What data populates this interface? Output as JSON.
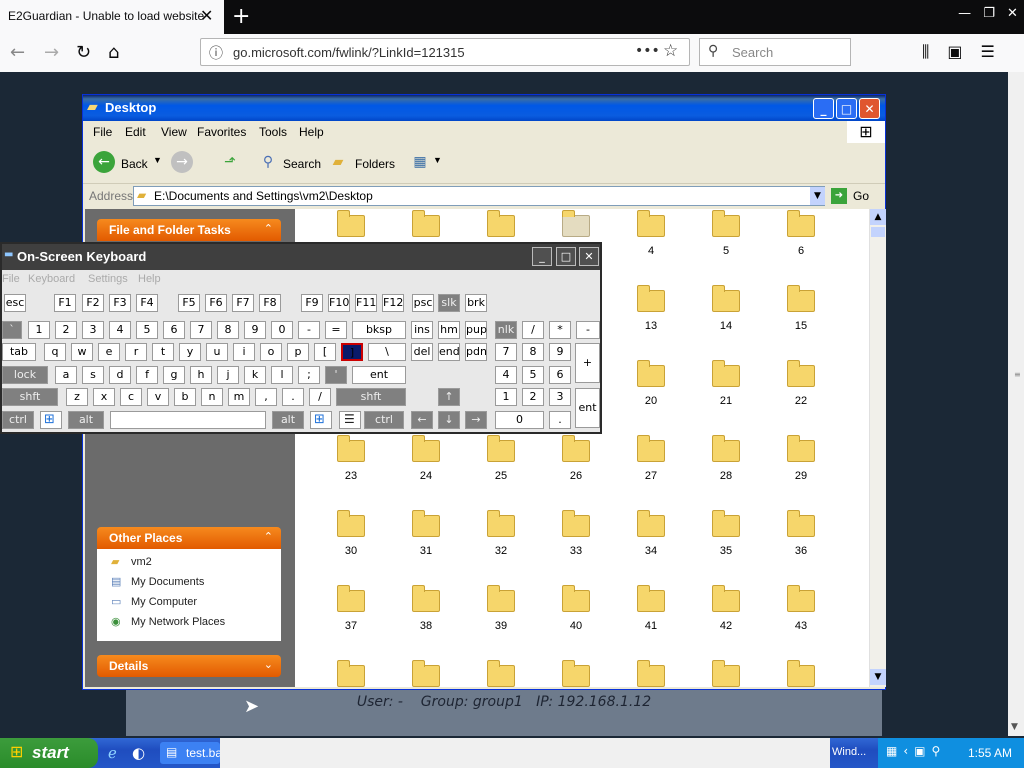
{
  "browser": {
    "tab_title": "E2Guardian - Unable to load website",
    "tab_close": "✕",
    "new_tab": "+",
    "win_min": "—",
    "win_restore": "❐",
    "win_close": "✕",
    "url": "go.microsoft.com/fwlink/?LinkId=121315",
    "url_more": "•••",
    "search_placeholder": "Search"
  },
  "remote": {
    "status_line": "User: -    Group: group1   IP: 192.168.1.12"
  },
  "explorer": {
    "title": "Desktop",
    "menu": [
      "File",
      "Edit",
      "View",
      "Favorites",
      "Tools",
      "Help"
    ],
    "toolbar": {
      "back": "Back",
      "search": "Search",
      "folders": "Folders"
    },
    "address_label": "Address",
    "address_value": "E:\\Documents and Settings\\vm2\\Desktop",
    "go_label": "Go",
    "panels": {
      "file_folder_tasks": "File and Folder Tasks",
      "other_places": "Other Places",
      "details": "Details"
    },
    "other_places_items": [
      "vm2",
      "My Documents",
      "My Computer",
      "My Network Places"
    ],
    "folders": [
      [
        "",
        "",
        "",
        "",
        "4",
        "5",
        "6"
      ],
      [
        "",
        "",
        "",
        "",
        "13",
        "14",
        "15"
      ],
      [
        "",
        "",
        "",
        "",
        "20",
        "21",
        "22"
      ],
      [
        "23",
        "24",
        "25",
        "26",
        "27",
        "28",
        "29"
      ],
      [
        "30",
        "31",
        "32",
        "33",
        "34",
        "35",
        "36"
      ],
      [
        "37",
        "38",
        "39",
        "40",
        "41",
        "42",
        "43"
      ],
      [
        "",
        "",
        "",
        "",
        "",
        "",
        ""
      ]
    ]
  },
  "osk": {
    "title": "On-Screen Keyboard",
    "menu": [
      "File",
      "Keyboard",
      "Settings",
      "Help"
    ],
    "rows": [
      [
        [
          "esc",
          2,
          22,
          0
        ],
        [
          "F1",
          52,
          22,
          0
        ],
        [
          "F2",
          80,
          22,
          0
        ],
        [
          "F3",
          107,
          22,
          0
        ],
        [
          "F4",
          134,
          22,
          0
        ],
        [
          "F5",
          176,
          22,
          0
        ],
        [
          "F6",
          203,
          22,
          0
        ],
        [
          "F7",
          230,
          22,
          0
        ],
        [
          "F8",
          257,
          22,
          0
        ],
        [
          "F9",
          299,
          22,
          0
        ],
        [
          "F10",
          326,
          22,
          0
        ],
        [
          "F11",
          353,
          22,
          0
        ],
        [
          "F12",
          380,
          22,
          0
        ],
        [
          "psc",
          410,
          22,
          0
        ],
        [
          "slk",
          436,
          22,
          1
        ],
        [
          "brk",
          463,
          22,
          0
        ]
      ],
      [
        [
          "`",
          0,
          20,
          1
        ],
        [
          "1",
          26,
          22,
          0
        ],
        [
          "2",
          53,
          22,
          0
        ],
        [
          "3",
          80,
          22,
          0
        ],
        [
          "4",
          107,
          22,
          0
        ],
        [
          "5",
          134,
          22,
          0
        ],
        [
          "6",
          161,
          22,
          0
        ],
        [
          "7",
          188,
          22,
          0
        ],
        [
          "8",
          215,
          22,
          0
        ],
        [
          "9",
          242,
          22,
          0
        ],
        [
          "0",
          269,
          22,
          0
        ],
        [
          "-",
          296,
          22,
          0
        ],
        [
          "=",
          323,
          22,
          0
        ],
        [
          "bksp",
          350,
          54,
          0
        ],
        [
          "ins",
          409,
          22,
          0
        ],
        [
          "hm",
          436,
          22,
          0
        ],
        [
          "pup",
          463,
          22,
          0
        ],
        [
          "nlk",
          493,
          22,
          1
        ],
        [
          "/",
          520,
          22,
          0
        ],
        [
          "*",
          547,
          22,
          0
        ],
        [
          "-",
          574,
          24,
          0
        ]
      ],
      [
        [
          "tab",
          0,
          34,
          0
        ],
        [
          "q",
          42,
          22,
          0
        ],
        [
          "w",
          69,
          22,
          0
        ],
        [
          "e",
          96,
          22,
          0
        ],
        [
          "r",
          123,
          22,
          0
        ],
        [
          "t",
          150,
          22,
          0
        ],
        [
          "y",
          177,
          22,
          0
        ],
        [
          "u",
          204,
          22,
          0
        ],
        [
          "i",
          231,
          22,
          0
        ],
        [
          "o",
          258,
          22,
          0
        ],
        [
          "p",
          285,
          22,
          0
        ],
        [
          "[",
          312,
          22,
          0
        ],
        [
          "]",
          339,
          22,
          2
        ],
        [
          "\\",
          366,
          38,
          0
        ],
        [
          "del",
          409,
          22,
          0
        ],
        [
          "end",
          436,
          22,
          0
        ],
        [
          "pdn",
          463,
          22,
          0
        ],
        [
          "7",
          493,
          22,
          0
        ],
        [
          "8",
          520,
          22,
          0
        ],
        [
          "9",
          547,
          22,
          0
        ]
      ],
      [
        [
          "lock",
          0,
          46,
          1
        ],
        [
          "a",
          53,
          22,
          0
        ],
        [
          "s",
          80,
          22,
          0
        ],
        [
          "d",
          107,
          22,
          0
        ],
        [
          "f",
          134,
          22,
          0
        ],
        [
          "g",
          161,
          22,
          0
        ],
        [
          "h",
          188,
          22,
          0
        ],
        [
          "j",
          215,
          22,
          0
        ],
        [
          "k",
          242,
          22,
          0
        ],
        [
          "l",
          269,
          22,
          0
        ],
        [
          ";",
          296,
          22,
          0
        ],
        [
          "'",
          323,
          22,
          1
        ],
        [
          "ent",
          350,
          54,
          0
        ],
        [
          "4",
          493,
          22,
          0
        ],
        [
          "5",
          520,
          22,
          0
        ],
        [
          "6",
          547,
          22,
          0
        ]
      ],
      [
        [
          "shft",
          0,
          56,
          1
        ],
        [
          "z",
          64,
          22,
          0
        ],
        [
          "x",
          91,
          22,
          0
        ],
        [
          "c",
          118,
          22,
          0
        ],
        [
          "v",
          145,
          22,
          0
        ],
        [
          "b",
          172,
          22,
          0
        ],
        [
          "n",
          199,
          22,
          0
        ],
        [
          "m",
          226,
          22,
          0
        ],
        [
          ",",
          253,
          22,
          0
        ],
        [
          ".",
          280,
          22,
          0
        ],
        [
          "/",
          307,
          22,
          0
        ],
        [
          "shft",
          334,
          70,
          1
        ],
        [
          "↑",
          436,
          22,
          1
        ],
        [
          "1",
          493,
          22,
          0
        ],
        [
          "2",
          520,
          22,
          0
        ],
        [
          "3",
          547,
          22,
          0
        ]
      ],
      [
        [
          "ctrl",
          0,
          32,
          1
        ],
        [
          "",
          38,
          22,
          0
        ],
        [
          "alt",
          66,
          36,
          1
        ],
        [
          "",
          108,
          156,
          0
        ],
        [
          "alt",
          270,
          32,
          1
        ],
        [
          "",
          308,
          22,
          0
        ],
        [
          "",
          337,
          22,
          0
        ],
        [
          "ctrl",
          362,
          40,
          1
        ],
        [
          "←",
          409,
          22,
          1
        ],
        [
          "↓",
          436,
          22,
          1
        ],
        [
          "→",
          463,
          22,
          1
        ],
        [
          "0",
          493,
          49,
          0
        ],
        [
          ".",
          547,
          22,
          0
        ]
      ]
    ],
    "tall_keys": [
      [
        "+",
        573,
        "row2"
      ],
      [
        "ent",
        573,
        "row4"
      ]
    ]
  },
  "taskbar": {
    "start": "start",
    "task_button": "test.ba",
    "task_window": "Wind...",
    "time": "1:55 AM"
  }
}
